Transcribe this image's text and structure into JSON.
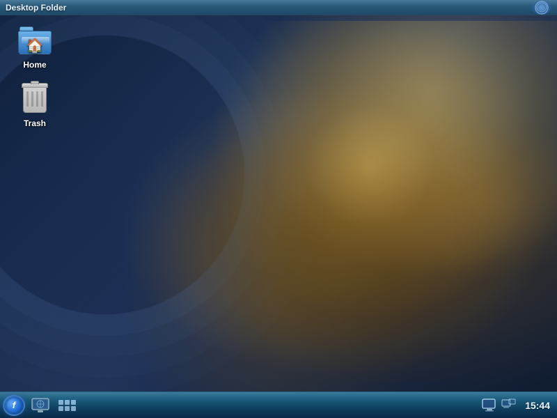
{
  "menubar": {
    "title": "Desktop Folder"
  },
  "desktop_icons": [
    {
      "id": "home",
      "label": "Home",
      "type": "folder"
    },
    {
      "id": "trash",
      "label": "Trash",
      "type": "trash"
    }
  ],
  "taskbar": {
    "start_button_label": "f",
    "clock": "15:44",
    "tray_icons": [
      "display",
      "network"
    ]
  },
  "corner_icon": "●"
}
